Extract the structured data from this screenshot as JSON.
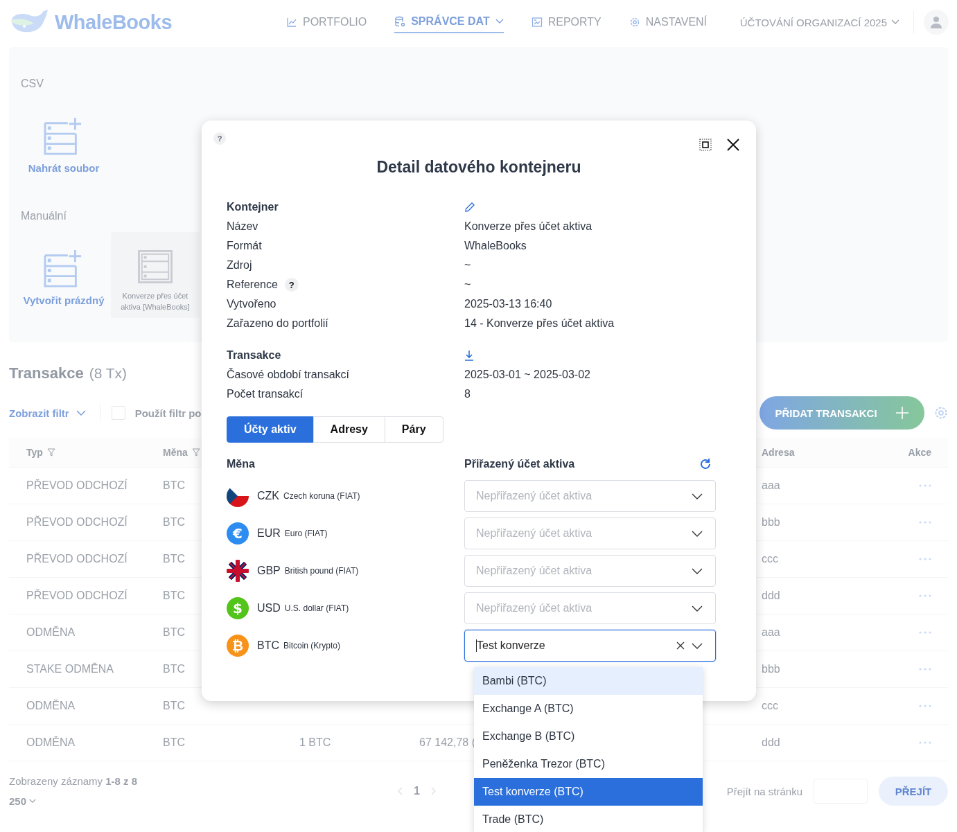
{
  "nav": {
    "logo": "WhaleBooks",
    "items": [
      {
        "label": "PORTFOLIO",
        "selected": false,
        "caret": false
      },
      {
        "label": "SPRÁVCE DAT",
        "selected": true,
        "caret": true
      },
      {
        "label": "REPORTY",
        "selected": false,
        "caret": false
      },
      {
        "label": "NASTAVENÍ",
        "selected": false,
        "caret": false
      }
    ],
    "organization": "ÚČTOVÁNÍ ORGANIZACÍ 2025"
  },
  "import_panel": {
    "sections": [
      {
        "title": "CSV",
        "items": [
          {
            "label": "Nahrát soubor",
            "kind": "add"
          }
        ]
      },
      {
        "title": "Manuální",
        "items": [
          {
            "label": "Vytvořit prázdný",
            "kind": "add"
          },
          {
            "label": "Konverze přes účet aktiva [WhaleBooks]",
            "kind": "container"
          }
        ]
      }
    ]
  },
  "transactions": {
    "title": "Transakce",
    "count": "(8 Tx)",
    "filter_toggle": "Zobrazit filtr",
    "filter_checkbox": {
      "label": "Použít filtr po",
      "checked": false
    },
    "add_button": "PŘIDAT TRANSAKCI",
    "columns": [
      {
        "label": "Typ",
        "filter": true
      },
      {
        "label": "Měna",
        "filter": true
      },
      {
        "label": "Adresa",
        "filter": false
      },
      {
        "label": "Akce",
        "filter": false
      }
    ],
    "rows": [
      {
        "type": "PŘEVOD ODCHOZÍ",
        "currency": "BTC",
        "address": "aaa"
      },
      {
        "type": "PŘEVOD ODCHOZÍ",
        "currency": "BTC",
        "address": "bbb"
      },
      {
        "type": "PŘEVOD ODCHOZÍ",
        "currency": "BTC",
        "address": "ccc"
      },
      {
        "type": "PŘEVOD ODCHOZÍ",
        "currency": "BTC",
        "address": "ddd"
      },
      {
        "type": "ODMĚNA",
        "currency": "BTC",
        "address": "aaa"
      },
      {
        "type": "STAKE ODMĚNA",
        "currency": "BTC",
        "address": "bbb"
      },
      {
        "type": "ODMĚNA",
        "currency": "BTC",
        "address": "ccc"
      },
      {
        "type": "ODMĚNA",
        "currency": "BTC",
        "column_3": "1 BTC",
        "column_4": "67 142,78 (",
        "address": "ddd"
      }
    ]
  },
  "footer": {
    "records": "Zobrazeny záznamy **1-8 z 8**",
    "page_size": "250",
    "current_page": "1",
    "goto_label": "Přejít na stránku",
    "goto_button": "PŘEJÍT"
  },
  "modal": {
    "help": "?",
    "title": "Detail datového kontejneru",
    "sections": [
      {
        "title": "Kontejner",
        "fields": [
          {
            "label": "Název",
            "value": "Konverze přes účet aktiva"
          },
          {
            "label": "Formát",
            "value": "WhaleBooks"
          },
          {
            "label": "Zdroj",
            "value": "~"
          },
          {
            "label": "Reference",
            "help": "?",
            "value": "~"
          },
          {
            "label": "Vytvořeno",
            "value": "2025-03-13 16:40"
          },
          {
            "label": "Zařazeno do portfolií",
            "value": "14 - Konverze přes účet aktiva"
          }
        ]
      },
      {
        "title": "Transakce",
        "fields": [
          {
            "label": "Časové období transakcí",
            "value": "2025-03-01 ~ 2025-03-02"
          },
          {
            "label": "Počet transakcí",
            "value": "8"
          }
        ]
      }
    ],
    "tabs": [
      {
        "label": "Účty aktiv",
        "selected": true
      },
      {
        "label": "Adresy",
        "selected": false
      },
      {
        "label": "Páry",
        "selected": false
      }
    ],
    "currency_header": "Měna",
    "account_header": "Přiřazený účet aktiva",
    "currencies": [
      {
        "code": "CZK",
        "name": "Czech koruna (FIAT)",
        "kind": "flag",
        "placeholder": "Nepřiřazený účet aktiva",
        "focused": false
      },
      {
        "code": "EUR",
        "name": "Euro (FIAT)",
        "kind": "coin",
        "symbol": "€",
        "color": "#2d8cf0",
        "placeholder": "Nepřiřazený účet aktiva",
        "focused": false
      },
      {
        "code": "GBP",
        "name": "British pound (FIAT)",
        "kind": "flag",
        "placeholder": "Nepřiřazený účet aktiva",
        "focused": false
      },
      {
        "code": "USD",
        "name": "U.S. dollar (FIAT)",
        "kind": "coin",
        "symbol": "$",
        "color": "#52c41a",
        "placeholder": "Nepřiřazený účet aktiva",
        "focused": false
      },
      {
        "code": "BTC",
        "name": "Bitcoin (Krypto)",
        "kind": "coin",
        "symbol": "₿",
        "color": "#f7931a",
        "value": "Test konverze",
        "focused": true
      }
    ],
    "dropdown": [
      {
        "label": "Bambi (BTC)",
        "selected": false,
        "highlighted": true
      },
      {
        "label": "Exchange A (BTC)",
        "selected": false,
        "highlighted": false
      },
      {
        "label": "Exchange B (BTC)",
        "selected": false,
        "highlighted": false
      },
      {
        "label": "Peněženka Trezor (BTC)",
        "selected": false,
        "highlighted": false
      },
      {
        "label": "Test konverze (BTC)",
        "selected": true,
        "highlighted": false
      },
      {
        "label": "Trade (BTC)",
        "selected": false,
        "highlighted": false
      }
    ]
  }
}
